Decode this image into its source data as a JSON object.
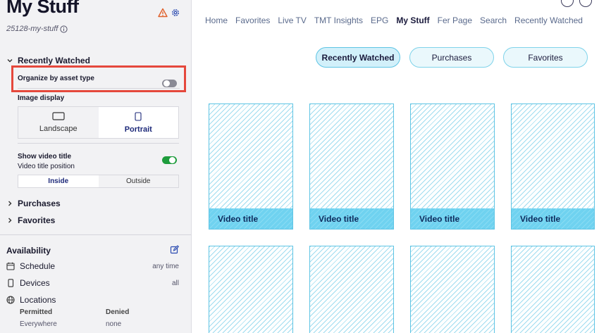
{
  "sidebar": {
    "title": "My Stuff",
    "slug": "25128-my-stuff",
    "recently_watched": {
      "label": "Recently Watched",
      "organize_label": "Organize by asset type",
      "organize_enabled": false,
      "image_display_label": "Image display",
      "image_options": [
        "Landscape",
        "Portrait"
      ],
      "image_selected": "Portrait",
      "show_title_label": "Show video title",
      "show_title_enabled": true,
      "title_position_label": "Video title position",
      "title_position_options": [
        "Inside",
        "Outside"
      ],
      "title_position_selected": "Inside"
    },
    "purchases_label": "Purchases",
    "favorites_label": "Favorites",
    "availability": {
      "title": "Availability",
      "schedule_label": "Schedule",
      "schedule_value": "any time",
      "devices_label": "Devices",
      "devices_value": "all",
      "locations_label": "Locations",
      "permitted_label": "Permitted",
      "permitted_value": "Everywhere",
      "denied_label": "Denied",
      "denied_value": "none"
    }
  },
  "nav": {
    "items": [
      "Home",
      "Favorites",
      "Live TV",
      "TMT Insights",
      "EPG",
      "My Stuff",
      "Fer Page",
      "Search",
      "Recently Watched"
    ],
    "active": "My Stuff"
  },
  "tabs": {
    "items": [
      "Recently Watched",
      "Purchases",
      "Favorites"
    ],
    "active": "Recently Watched"
  },
  "cards": {
    "title": "Video title"
  },
  "colors": {
    "accent": "#5ec4e4",
    "highlight": "#e5483c",
    "toggle_on": "#1e9c3c"
  }
}
